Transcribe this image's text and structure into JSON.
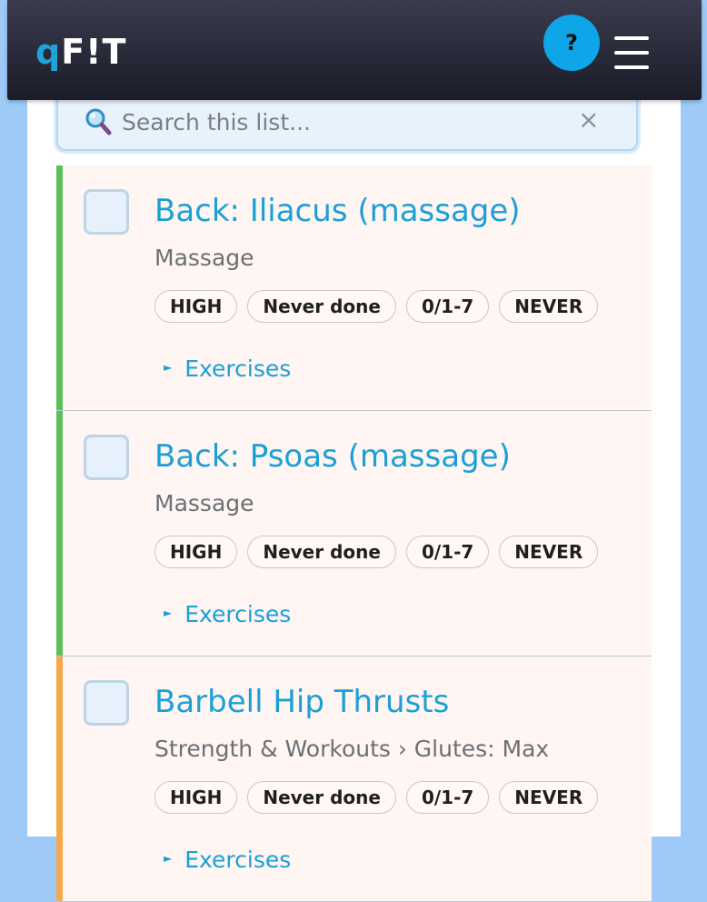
{
  "header": {
    "logo_q": "q",
    "logo_rest": "F!T",
    "help_label": "?"
  },
  "search": {
    "placeholder": "Search this list...",
    "clear_label": "×"
  },
  "items": [
    {
      "title": "Back: Iliacus (massage)",
      "category": "Massage",
      "status_color": "#5cc05c",
      "tags": [
        "HIGH",
        "Never done",
        "0/1-7",
        "NEVER"
      ],
      "exercises_label": "Exercises"
    },
    {
      "title": "Back: Psoas (massage)",
      "category": "Massage",
      "status_color": "#5cc05c",
      "tags": [
        "HIGH",
        "Never done",
        "0/1-7",
        "NEVER"
      ],
      "exercises_label": "Exercises"
    },
    {
      "title": "Barbell Hip Thrusts",
      "category": "Strength & Workouts › Glutes: Max",
      "status_color": "#f5a94a",
      "tags": [
        "HIGH",
        "Never done",
        "0/1-7",
        "NEVER"
      ],
      "exercises_label": "Exercises"
    }
  ],
  "colors": {
    "accent": "#1ba0d6",
    "header_bg": "#262735",
    "help_button": "#0ea5e9",
    "page_bg": "#9dcaf7",
    "item_bg": "#fff5f3"
  },
  "icons": {
    "search": "search-icon",
    "clear": "close-icon",
    "menu": "hamburger-menu-icon",
    "expand": "triangle-right-icon"
  }
}
